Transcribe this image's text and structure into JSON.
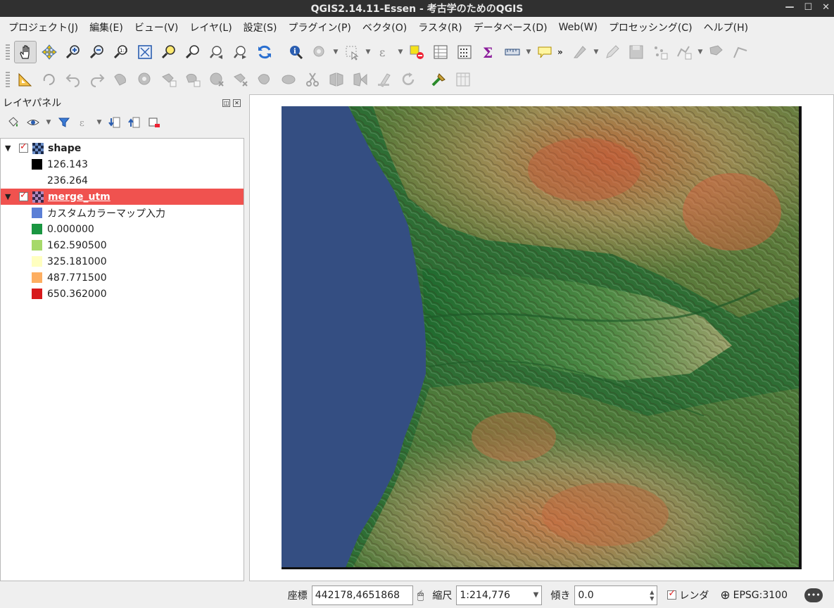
{
  "window": {
    "title": "QGIS2.14.11-Essen - 考古学のためのQGIS"
  },
  "menu": [
    "プロジェクト(J)",
    "編集(E)",
    "ビュー(V)",
    "レイヤ(L)",
    "設定(S)",
    "プラグイン(P)",
    "ベクタ(O)",
    "ラスタ(R)",
    "データベース(D)",
    "Web(W)",
    "プロセッシング(C)",
    "ヘルプ(H)"
  ],
  "layers_panel": {
    "title": "レイヤパネル",
    "layers": [
      {
        "name": "shape",
        "visible": true,
        "selected": false,
        "legend": [
          {
            "label": "126.143",
            "color": "#000000"
          },
          {
            "label": "236.264",
            "color": "#ffffff"
          }
        ]
      },
      {
        "name": "merge_utm",
        "visible": true,
        "selected": true,
        "legend": [
          {
            "label": "カスタムカラーマップ入力",
            "color": "#5b7fd6"
          },
          {
            "label": "0.000000",
            "color": "#1a9641"
          },
          {
            "label": "162.590500",
            "color": "#a6d96a"
          },
          {
            "label": "325.181000",
            "color": "#ffffc0"
          },
          {
            "label": "487.771500",
            "color": "#fdae61"
          },
          {
            "label": "650.362000",
            "color": "#d7191c"
          }
        ]
      }
    ]
  },
  "status": {
    "coord_label": "座標",
    "coord_value": "442178,4651868",
    "scale_label": "縮尺",
    "scale_value": "1:214,776",
    "rotation_label": "傾き",
    "rotation_value": "0.0",
    "render_label": "レンダ",
    "crs_label": "EPSG:3100"
  }
}
